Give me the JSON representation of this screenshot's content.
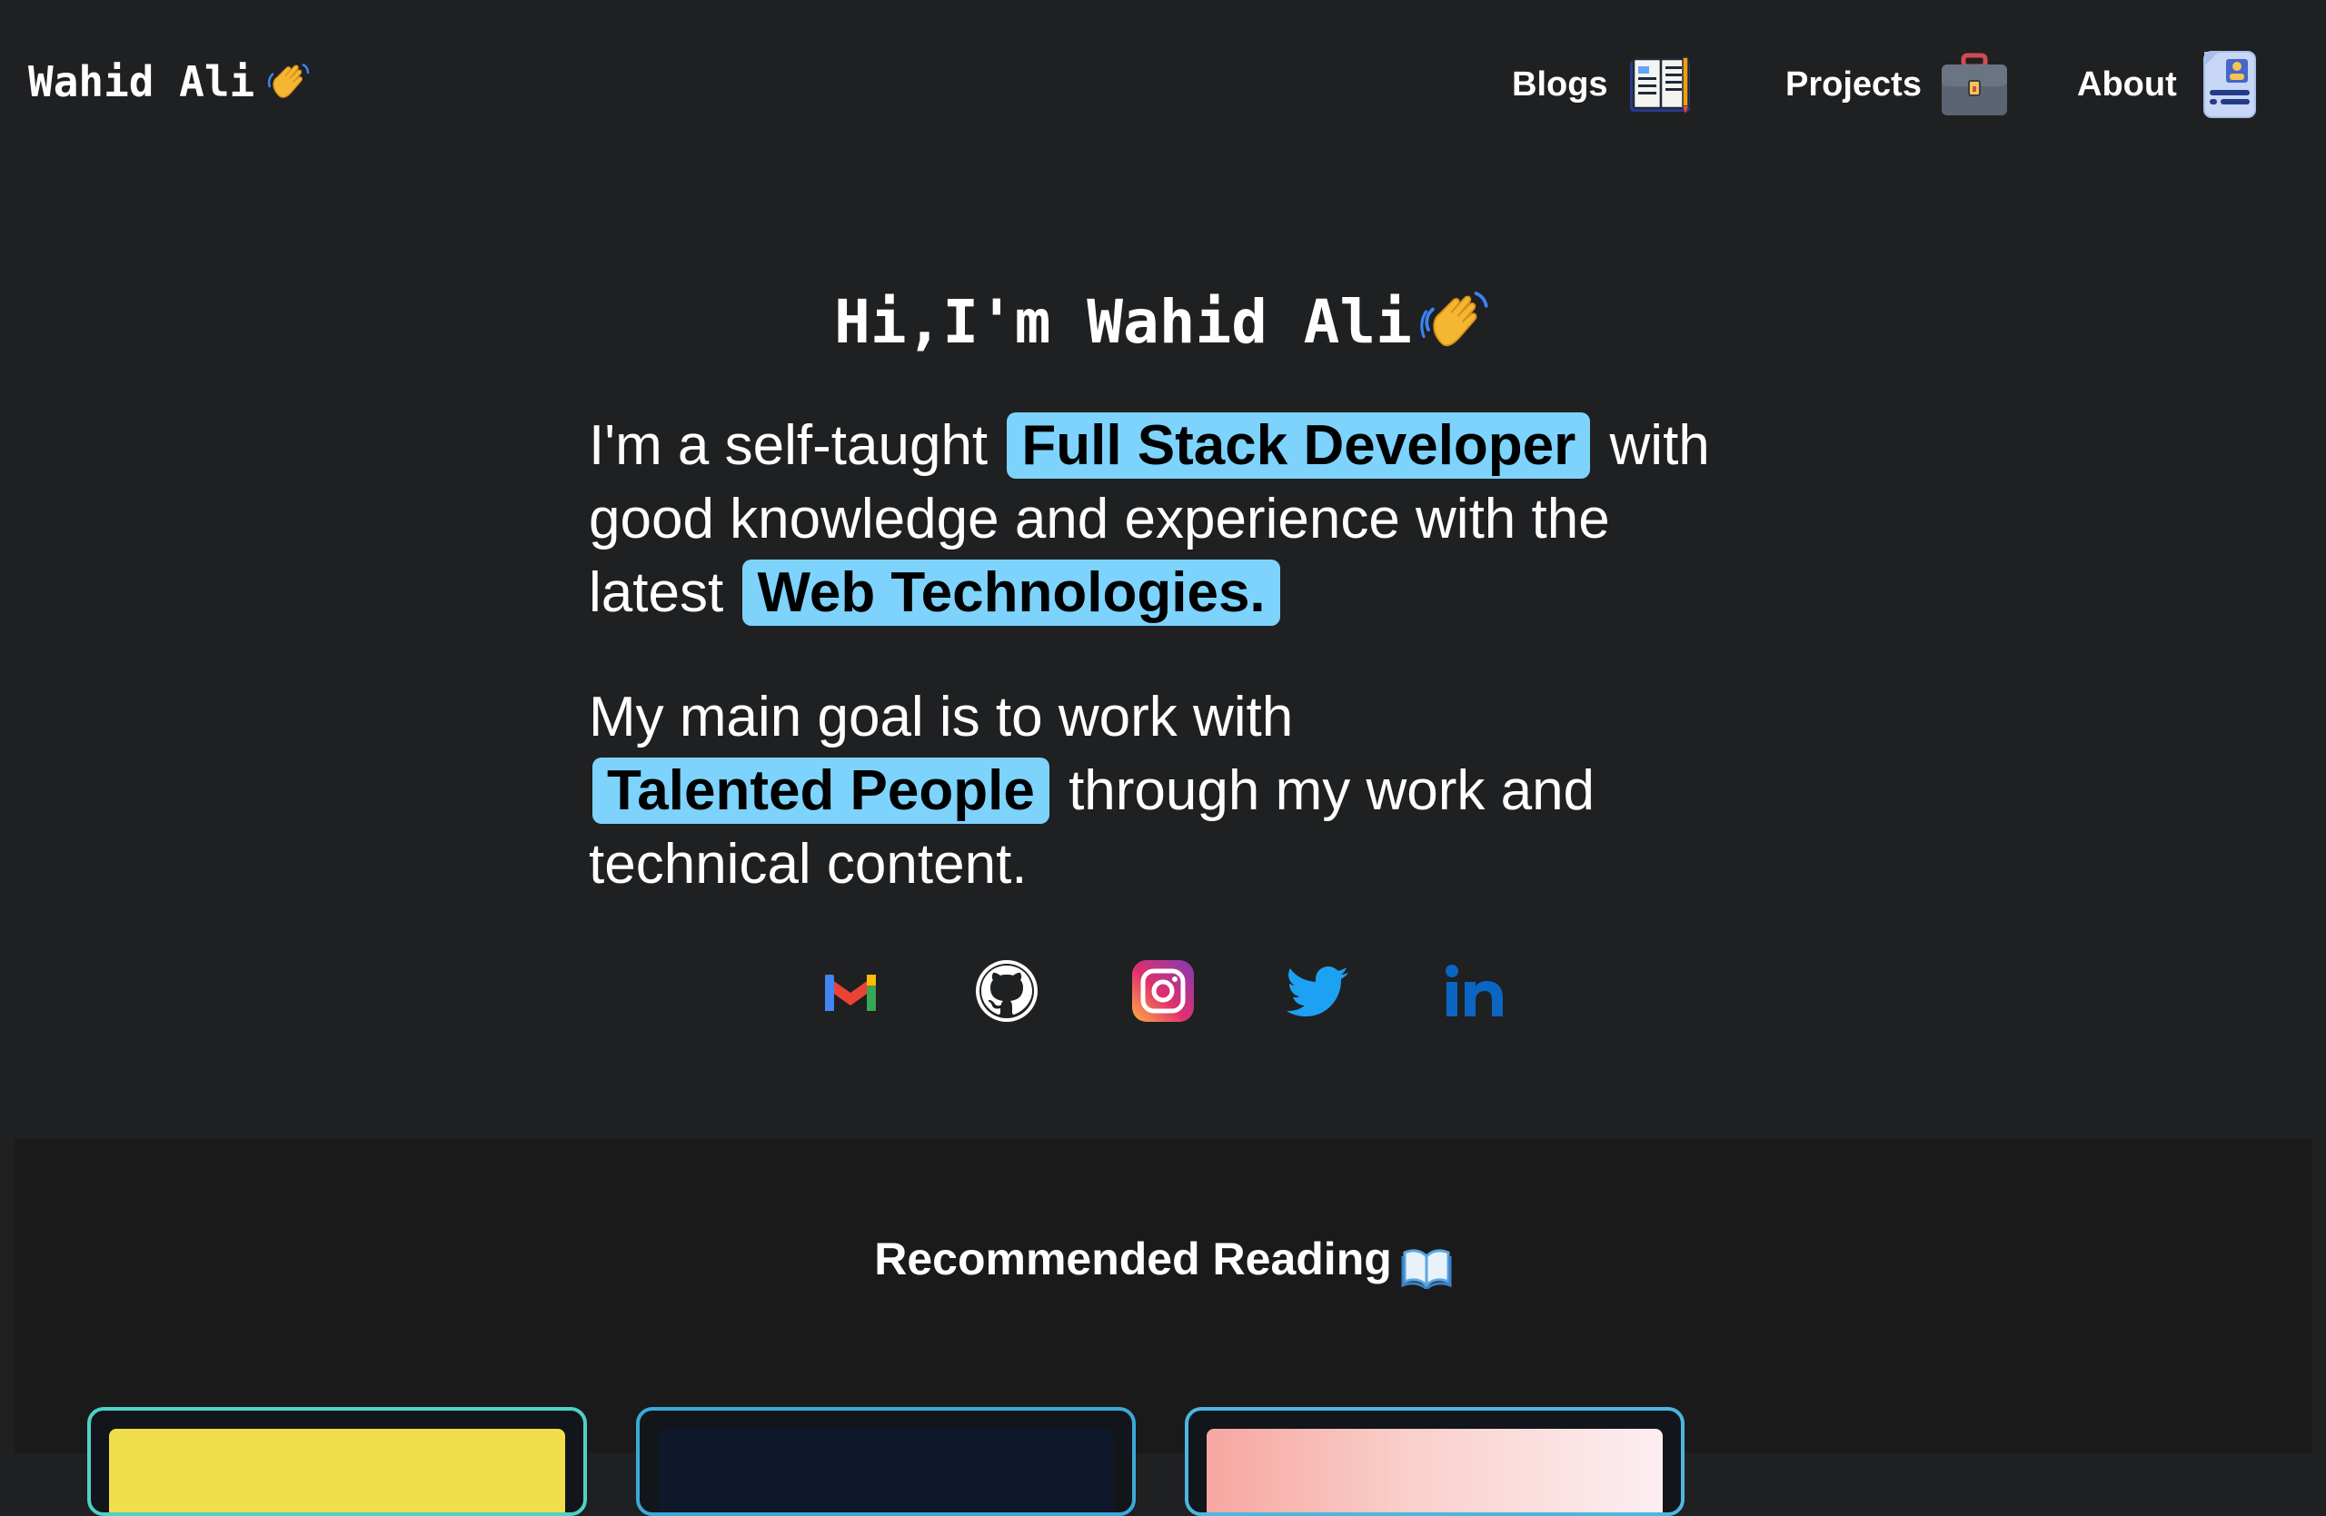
{
  "nav": {
    "brand": "Wahid Ali",
    "links": [
      {
        "label": "Blogs",
        "icon": "book-reading-icon"
      },
      {
        "label": "Projects",
        "icon": "briefcase-icon"
      },
      {
        "label": "About",
        "icon": "id-card-icon"
      }
    ]
  },
  "hero": {
    "title": "Hi,I'm Wahid Ali",
    "p1": {
      "before": "I'm a self-taught",
      "highlight1": "Full Stack Developer",
      "middle": "with good knowledge and experience with the latest",
      "highlight2": "Web Technologies."
    },
    "p2": {
      "before": "My main goal is to work with",
      "highlight": "Talented People",
      "after": "through my work and technical content."
    }
  },
  "socials": [
    {
      "name": "Gmail",
      "icon": "gmail-icon"
    },
    {
      "name": "GitHub",
      "icon": "github-icon"
    },
    {
      "name": "Instagram",
      "icon": "instagram-icon"
    },
    {
      "name": "Twitter",
      "icon": "twitter-icon"
    },
    {
      "name": "LinkedIn",
      "icon": "linkedin-icon"
    }
  ],
  "recommended": {
    "title": "Recommended Reading"
  },
  "colors": {
    "background": "#1f2021",
    "section_background": "#1a1a1b",
    "highlight": "#7dd3fc",
    "card_border": "#38bdf8"
  }
}
